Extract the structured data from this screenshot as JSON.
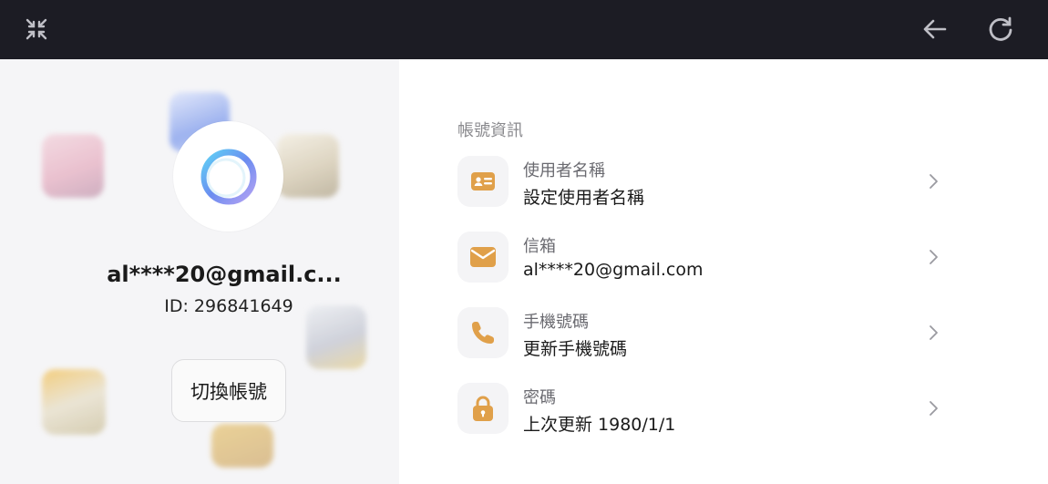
{
  "topbar": {
    "icons": [
      "collapse-icon",
      "back-arrow-icon",
      "reload-icon"
    ],
    "background": "#1c1c24"
  },
  "profile": {
    "email": "al****20@gmail.c...",
    "id_text": "ID: 296841649",
    "switch_button": "切換帳號",
    "avatar_icon": "ring-logo-icon"
  },
  "account": {
    "section_title": "帳號資訊",
    "accent": "#e0a04a",
    "items": [
      {
        "label": "使用者名稱",
        "value": "設定使用者名稱",
        "icon": "id-card-icon"
      },
      {
        "label": "信箱",
        "value": "al****20@gmail.com",
        "icon": "mail-icon"
      },
      {
        "label": "手機號碼",
        "value": "更新手機號碼",
        "icon": "phone-icon"
      },
      {
        "label": "密碼",
        "value": "上次更新 1980/1/1",
        "icon": "lock-icon"
      }
    ]
  }
}
